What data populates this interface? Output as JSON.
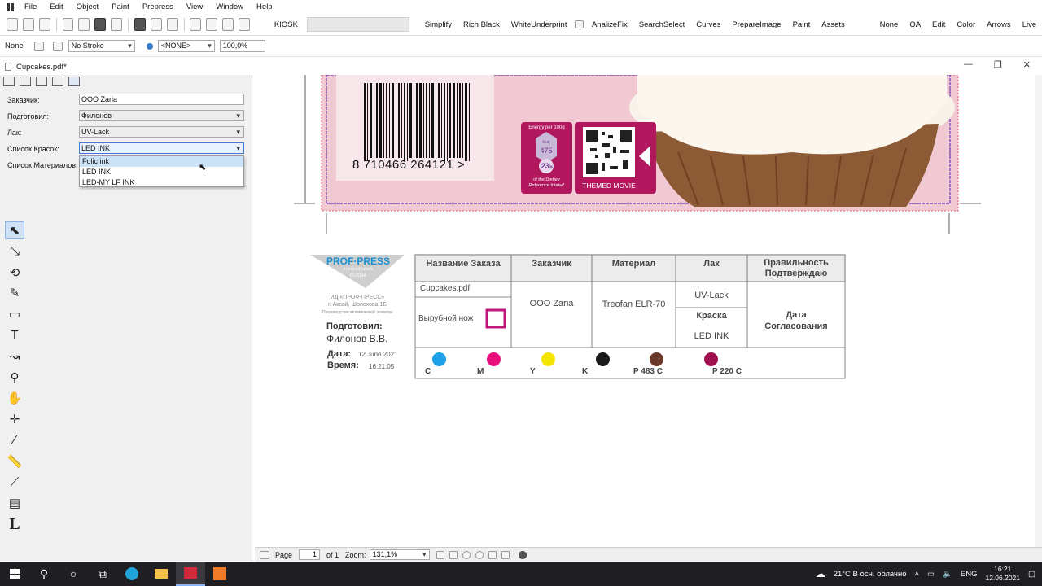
{
  "menu": [
    "File",
    "Edit",
    "Object",
    "Paint",
    "Prepress",
    "View",
    "Window",
    "Help"
  ],
  "toolbar": {
    "kiosk_label": "KIOSK",
    "buttons": [
      "Simplify",
      "Rich Black",
      "WhiteUnderprint",
      "AnalizeFix",
      "SearchSelect",
      "Curves",
      "PrepareImage",
      "Paint",
      "Assets",
      "None",
      "QA",
      "Edit",
      "Color",
      "Arrows",
      "Live"
    ]
  },
  "props": {
    "fill": "None",
    "stroke": "No Stroke",
    "swatch": "<NONE>",
    "opacity": "100,0%"
  },
  "doc": {
    "tab": "Cupcakes.pdf*"
  },
  "window_controls": [
    "—",
    "❐",
    "✕"
  ],
  "panel": {
    "customer_label": "Заказчик:",
    "customer_value": "OOO Zaria",
    "prepared_label": "Подготовил:",
    "prepared_value": "Филонов",
    "varnish_label": "Лак:",
    "varnish_value": "UV-Lack",
    "inks_label": "Список Красок:",
    "inks_value": "LED INK",
    "materials_label": "Список Материалов:",
    "dropdown_options": [
      "Folic ink",
      "LED INK",
      "LED-MY LF INK"
    ]
  },
  "label": {
    "barcode_digits": "8  710466  264121",
    "barcode_arrow": ">",
    "energy_title": "Energy per 100g",
    "kcal": "kcal",
    "kcal_value": "475",
    "percent": "23",
    "percent_sign": "%",
    "intake": "of the Dietary Reference Intake*",
    "themed": "THEMED MOVIE"
  },
  "stamp": {
    "logo": "PROF·PRESS",
    "logo_sub1": "in-mould labels",
    "logo_sub2": "RUSSIA",
    "addr1": "ИД «ПРОФ-ПРЕСС»",
    "addr2": "г. Аксай, Шолохова 1Б",
    "addr3": "Производство вплавляемой этикетки",
    "prepared_title": "Подготовил:",
    "prepared_name": "Филонов В.В.",
    "date_label": "Дата:",
    "date_value": "12 Juno 2021",
    "time_label": "Время:",
    "time_value": "16:21:05",
    "col_order": "Название Заказа",
    "col_customer": "Заказчик",
    "col_material": "Материал",
    "col_varnish": "Лак",
    "col_approve1": "Правильность",
    "col_approve2": "Подтверждаю",
    "file": "Cupcakes.pdf",
    "cut": "Вырубной нож",
    "customer": "OOO Zaria",
    "material": "Treofan ELR-70",
    "varnish": "UV-Lack",
    "ink_title": "Краска",
    "ink": "LED INK",
    "approve_date1": "Дата",
    "approve_date2": "Согласования",
    "inks": [
      {
        "name": "C",
        "color": "#1ea0e6"
      },
      {
        "name": "M",
        "color": "#e8107f"
      },
      {
        "name": "Y",
        "color": "#f5e400"
      },
      {
        "name": "K",
        "color": "#1a1a1a"
      },
      {
        "name": "P 483 C",
        "color": "#6b3a2b"
      },
      {
        "name": "P 220 C",
        "color": "#a0104f"
      }
    ]
  },
  "status": {
    "page_label": "Page",
    "page_value": "1",
    "of": "of 1",
    "zoom_label": "Zoom:",
    "zoom_value": "131,1%"
  },
  "tray": {
    "weather": "21°C  В осн. облачно",
    "lang": "ENG",
    "time": "16:21",
    "date": "12.06.2021"
  }
}
